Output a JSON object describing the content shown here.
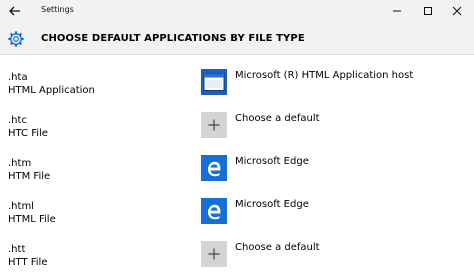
{
  "window": {
    "title": "Settings"
  },
  "header": {
    "title": "CHOOSE DEFAULT APPLICATIONS BY FILE TYPE"
  },
  "rows": [
    {
      "extension": ".hta",
      "file_type": "HTML Application",
      "app": "Microsoft (R) HTML Application host",
      "icon": "hta-app-icon"
    },
    {
      "extension": ".htc",
      "file_type": "HTC File",
      "app": "Choose a default",
      "icon": "plus-icon"
    },
    {
      "extension": ".htm",
      "file_type": "HTM File",
      "app": "Microsoft Edge",
      "icon": "edge-icon"
    },
    {
      "extension": ".html",
      "file_type": "HTML File",
      "app": "Microsoft Edge",
      "icon": "edge-icon"
    },
    {
      "extension": ".htt",
      "file_type": "HTT File",
      "app": "Choose a default",
      "icon": "plus-icon"
    }
  ],
  "colors": {
    "accent": "#1570d6",
    "titlebar": "#f2f2f2",
    "plus_tile": "#d4d4d4"
  }
}
